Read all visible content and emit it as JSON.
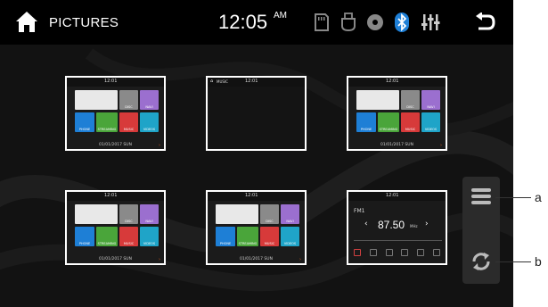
{
  "header": {
    "title": "PICTURES",
    "time": "12:05",
    "ampm": "AM",
    "icons": [
      "sd-card-icon",
      "usb-icon",
      "disc-icon",
      "bluetooth-icon",
      "equalizer-icon",
      "back-icon"
    ]
  },
  "thumbnails": [
    {
      "type": "home-menu",
      "clock": "12:01",
      "date": "01/01/2017  SUN"
    },
    {
      "type": "music",
      "label": "MUSIC",
      "clock": "12:01"
    },
    {
      "type": "home-menu",
      "clock": "12:01",
      "date": "01/01/2017  SUN"
    },
    {
      "type": "home-menu",
      "clock": "12:01",
      "date": "01/01/2017  SUN"
    },
    {
      "type": "home-menu",
      "clock": "12:01",
      "date": "01/01/2017  SUN"
    },
    {
      "type": "radio",
      "clock": "12:01",
      "band": "FM1",
      "frequency": "87.50",
      "unit": "MHz"
    }
  ],
  "tiles": {
    "phone": "PHONE",
    "streaming": "STREAMING",
    "music": "MUSIC",
    "videos": "VIDEOS",
    "disc": "DISC",
    "navi": "NAVI"
  },
  "side_panel": {
    "labels": [
      "a",
      "b"
    ]
  },
  "colors": {
    "blue": "#1e7fd6",
    "green": "#4aa53a",
    "red": "#d73a3a",
    "teal": "#1fa4c8",
    "purple": "#9b6fcf",
    "grey": "#8a8a8a"
  }
}
